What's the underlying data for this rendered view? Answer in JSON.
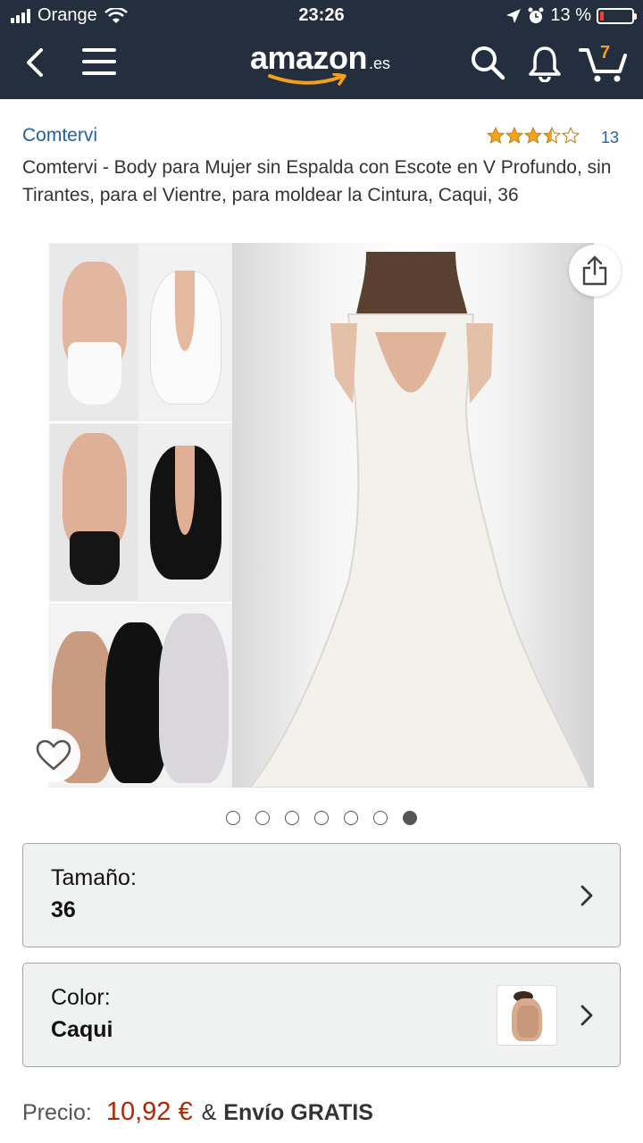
{
  "status_bar": {
    "carrier": "Orange",
    "time": "23:26",
    "battery": "13 %",
    "battery_level": 0.13
  },
  "nav": {
    "logo_word": "amazon",
    "logo_tld": ".es",
    "cart_count": "7",
    "icons": [
      "back-arrow-icon",
      "hamburger-menu-icon",
      "search-icon",
      "bell-icon",
      "cart-icon"
    ]
  },
  "product": {
    "brand": "Comtervi",
    "rating_stars": 3.5,
    "rating_count": "13",
    "title": "Comtervi - Body para Mujer sin Espalda con Escote en V Profundo, sin Tirantes, para el Vientre, para moldear la Cintura, Caqui, 36"
  },
  "gallery": {
    "image_count": 7,
    "active_index": 6,
    "icons": [
      "share-icon",
      "heart-icon"
    ]
  },
  "options": {
    "size": {
      "label": "Tamaño:",
      "value": "36"
    },
    "color": {
      "label": "Color:",
      "value": "Caqui"
    }
  },
  "price": {
    "label": "Precio:",
    "amount": "10,92 €",
    "amp": "&",
    "shipping": "Envío GRATIS"
  },
  "colors": {
    "header_bg": "#232f3e",
    "link": "#2162a1",
    "price": "#b12704",
    "star": "#f4a41c",
    "cart_badge": "#f6a01a",
    "option_bg": "#f0f2f2"
  }
}
